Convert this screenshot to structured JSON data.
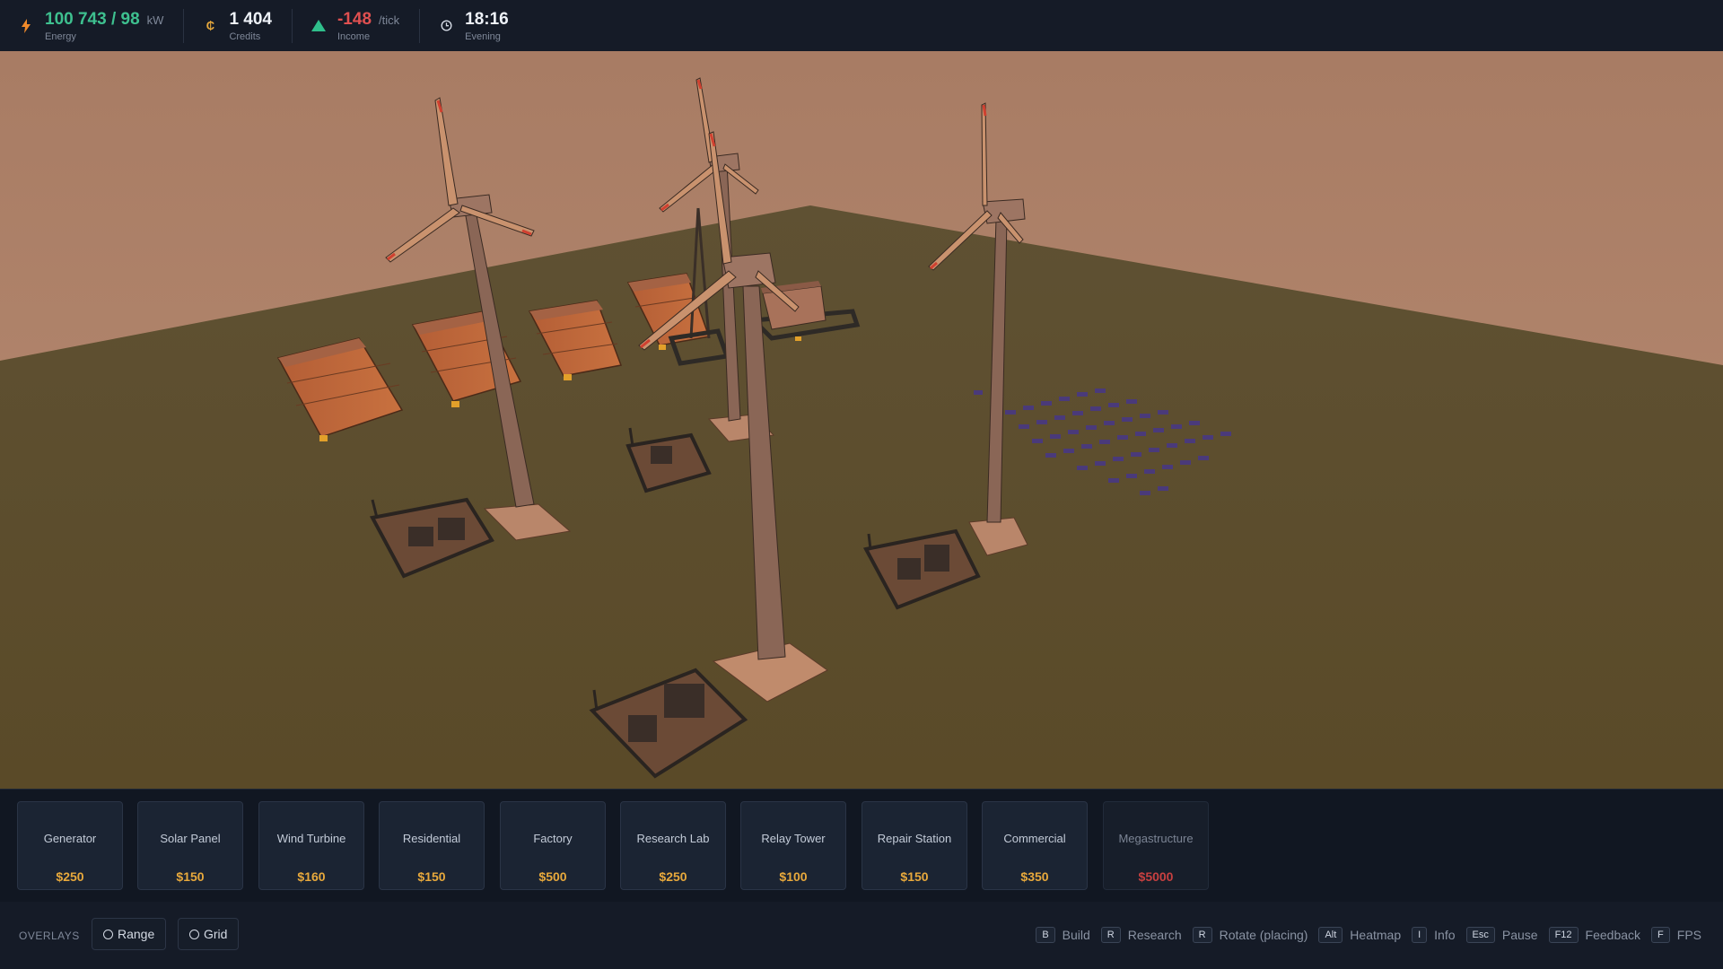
{
  "hud": {
    "energy": {
      "value": "100 743 / 98",
      "unit": "kW",
      "label": "Energy",
      "icon": "lightning-icon"
    },
    "credits": {
      "value": "1 404",
      "label": "Credits",
      "icon": "coin-icon"
    },
    "income": {
      "value": "-148",
      "unit": "/tick",
      "label": "Income",
      "icon": "triangle-up-icon"
    },
    "time": {
      "value": "18:16",
      "label": "Evening",
      "icon": "clock-icon"
    }
  },
  "build": {
    "items": [
      {
        "name": "Generator",
        "price": "$250"
      },
      {
        "name": "Solar Panel",
        "price": "$150"
      },
      {
        "name": "Wind Turbine",
        "price": "$160"
      },
      {
        "name": "Residential",
        "price": "$150"
      },
      {
        "name": "Factory",
        "price": "$500"
      },
      {
        "name": "Research Lab",
        "price": "$250"
      },
      {
        "name": "Relay Tower",
        "price": "$100"
      },
      {
        "name": "Repair Station",
        "price": "$150"
      },
      {
        "name": "Commercial",
        "price": "$350"
      },
      {
        "name": "Megastructure",
        "price": "$5000"
      }
    ]
  },
  "overlays": {
    "label": "OVERLAYS",
    "range": "Range",
    "grid": "Grid"
  },
  "shortcuts": [
    {
      "key": "B",
      "desc": "Build"
    },
    {
      "key": "R",
      "desc": "Research"
    },
    {
      "key": "R",
      "desc": "Rotate (placing)"
    },
    {
      "key": "Alt",
      "desc": "Heatmap"
    },
    {
      "key": "I",
      "desc": "Info"
    },
    {
      "key": "Esc",
      "desc": "Pause"
    },
    {
      "key": "F12",
      "desc": "Feedback"
    },
    {
      "key": "F",
      "desc": "FPS"
    }
  ],
  "colors": {
    "energy": "#3ec08f",
    "income": "#e05050",
    "price": "#e8a93c",
    "price_unaffordable": "#c84040",
    "sky": "#a77d66",
    "ground": "#5d4e2e"
  }
}
